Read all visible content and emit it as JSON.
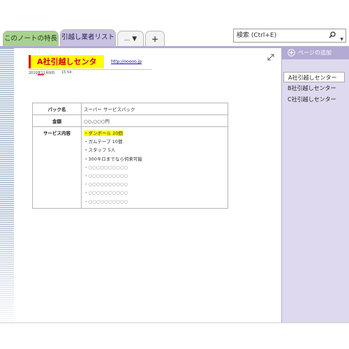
{
  "tabs": [
    {
      "label": "このノートの特長",
      "color": "#a9d18e"
    },
    {
      "label": "引越し業者リスト",
      "color": "#c9c1e0"
    }
  ],
  "more_tabs_label": "... ▼",
  "add_tab_label": "+",
  "search": {
    "placeholder": "検索 (Ctrl+E)",
    "icon": "search-icon"
  },
  "page": {
    "title": "A社引越しセンター",
    "link": "http://ooooo.jp",
    "date": "2010年11月9日",
    "time": "15:54",
    "table": {
      "rows": [
        {
          "label": "パック名",
          "value": "スーパー サービスパック"
        },
        {
          "label": "金額",
          "value": "○○,○○○円"
        },
        {
          "label": "サービス内容"
        }
      ],
      "services": [
        "・ダンボール 20個",
        "・ガムテープ 10個",
        "・スタッフ 5人",
        "・300キロまでなら何来可能",
        "・○○○○○○○○○○",
        "・○○○○○○○○○○",
        "・○○○○○○○○○○",
        "・○○○○○○○○○○",
        "・○○○○○○○○○○"
      ]
    }
  },
  "sidebar": {
    "add_page_label": "ページの追加",
    "items": [
      {
        "label": "A社引越しセンター",
        "selected": true
      },
      {
        "label": "B社引越しセンター",
        "selected": false
      },
      {
        "label": "C社引越しセンター",
        "selected": false
      }
    ]
  },
  "colors": {
    "accent": "#b3abd3",
    "panel": "#ded9ee",
    "highlight": "#ffff00",
    "title_text": "#d40000"
  }
}
